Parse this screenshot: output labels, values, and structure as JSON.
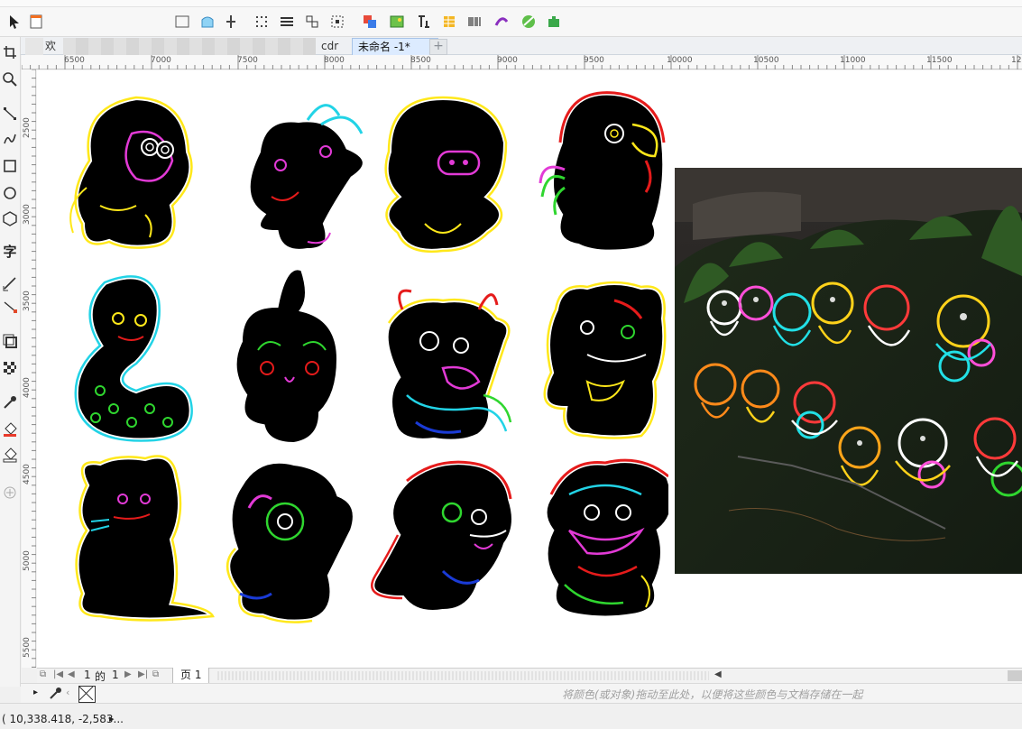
{
  "document_tabs": {
    "first_partial": "欢",
    "second_partial": "cdr",
    "active": "未命名 -1*",
    "add": "+"
  },
  "rulers": {
    "horizontal": [
      "6500",
      "7000",
      "7500",
      "8000",
      "8500",
      "9000",
      "9500",
      "10000",
      "10500",
      "11000",
      "11500",
      "12"
    ],
    "vertical": [
      "2500",
      "3000",
      "3500",
      "4000",
      "4500",
      "5000",
      "5500"
    ]
  },
  "toolbox": {
    "text_tool": "字"
  },
  "page_nav": {
    "current": "1",
    "of": "的",
    "total": "1",
    "page_tab": "页 1"
  },
  "color_dock": {
    "hint": "将颜色(或对象)拖动至此处，以便将这些颜色与文档存储在一起"
  },
  "status": {
    "coordinates": "( 10,338.418, -2,583...",
    "arrow": "▸"
  },
  "artwork": {
    "zodiac": [
      "monkey",
      "goat",
      "pig",
      "rooster",
      "snake",
      "rabbit",
      "ox",
      "tiger",
      "rat",
      "dog",
      "horse",
      "dragon"
    ],
    "photo": "neon-zodiac-wall-photo"
  },
  "colors": {
    "neon_yellow": "#ffe81a",
    "neon_cyan": "#22d3e6",
    "neon_magenta": "#e23ad6",
    "neon_red": "#e51b1b",
    "neon_green": "#2fd62f",
    "neon_blue": "#1a3bd6",
    "neon_white": "#ffffff",
    "tab_active": "#dcebff"
  }
}
